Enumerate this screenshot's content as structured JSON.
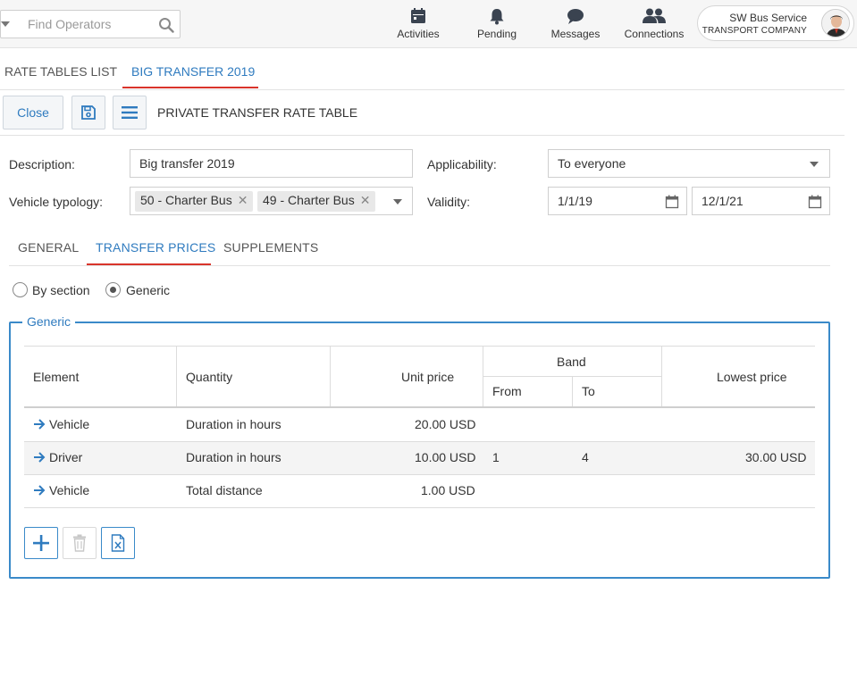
{
  "search": {
    "placeholder": "Find Operators"
  },
  "nav": [
    {
      "label": "Activities",
      "icon": "calendar-icon"
    },
    {
      "label": "Pending",
      "icon": "bell-icon"
    },
    {
      "label": "Messages",
      "icon": "chat-icon"
    },
    {
      "label": "Connections",
      "icon": "users-icon"
    }
  ],
  "user": {
    "name": "SW Bus Service",
    "company": "TRANSPORT COMPANY"
  },
  "doc_tabs": [
    {
      "label": "RATE TABLES LIST"
    },
    {
      "label": "BIG TRANSFER 2019"
    }
  ],
  "toolbar": {
    "close_label": "Close",
    "title": "PRIVATE TRANSFER RATE TABLE"
  },
  "form": {
    "description_label": "Description:",
    "description_value": "Big transfer 2019",
    "applicability_label": "Applicability:",
    "applicability_value": "To everyone",
    "vehicle_label": "Vehicle typology:",
    "vehicle_chips": [
      "50 - Charter Bus",
      "49 - Charter Bus"
    ],
    "validity_label": "Validity:",
    "validity_from": "1/1/19",
    "validity_to": "12/1/21"
  },
  "inner_tabs": [
    {
      "label": "GENERAL"
    },
    {
      "label": "TRANSFER PRICES"
    },
    {
      "label": "SUPPLEMENTS"
    }
  ],
  "radios": {
    "by_section": "By section",
    "generic": "Generic",
    "selected": "Generic"
  },
  "fieldset": {
    "legend": "Generic"
  },
  "table": {
    "headers": {
      "element": "Element",
      "quantity": "Quantity",
      "unit_price": "Unit price",
      "band": "Band",
      "from": "From",
      "to": "To",
      "lowest_price": "Lowest price"
    },
    "rows": [
      {
        "element": "Vehicle",
        "quantity": "Duration in hours",
        "unit_price": "20.00 USD",
        "from": "",
        "to": "",
        "lowest_price": ""
      },
      {
        "element": "Driver",
        "quantity": "Duration in hours",
        "unit_price": "10.00 USD",
        "from": "1",
        "to": "4",
        "lowest_price": "30.00 USD"
      },
      {
        "element": "Vehicle",
        "quantity": "Total distance",
        "unit_price": "1.00 USD",
        "from": "",
        "to": "",
        "lowest_price": ""
      }
    ]
  },
  "colors": {
    "accent": "#2f7bbf",
    "active_underline": "#d9342b",
    "border": "#3a8ac9"
  }
}
